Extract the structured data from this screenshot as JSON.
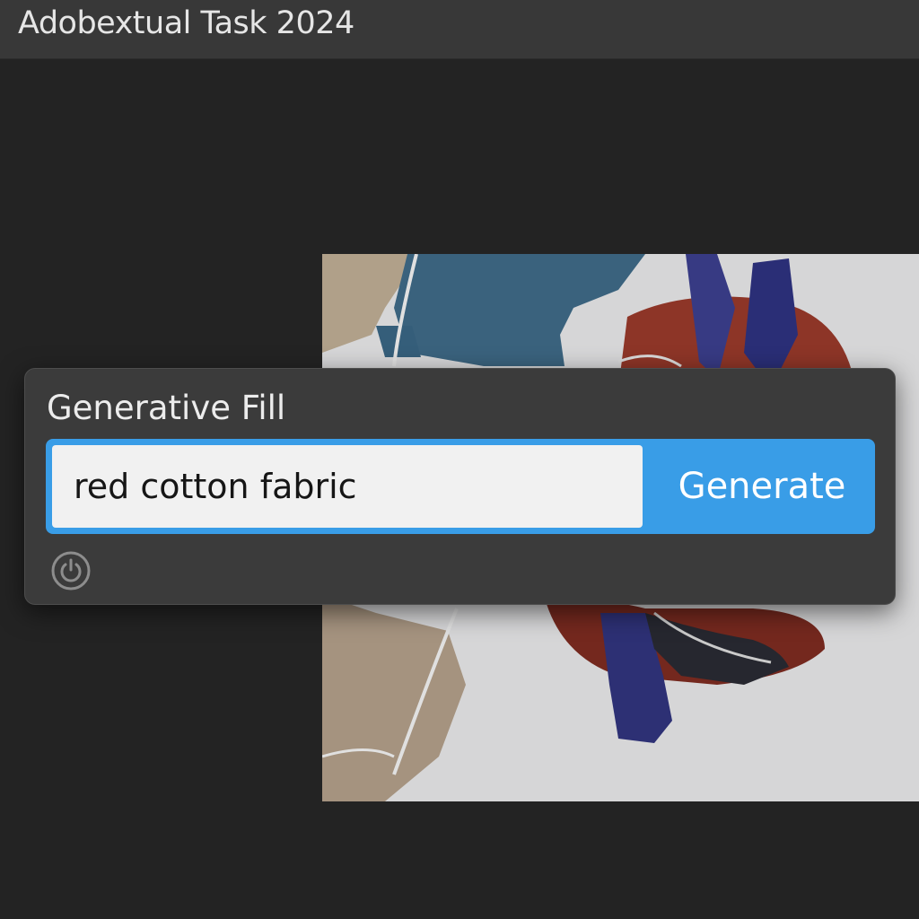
{
  "app": {
    "title": "Adobextual Task 2024"
  },
  "panel": {
    "title": "Generative Fill",
    "prompt_value": "red cotton fabric",
    "generate_label": "Generate",
    "history_icon": "power-refresh-icon"
  },
  "colors": {
    "accent": "#399de7",
    "panel_bg": "#3b3b3b",
    "app_bg": "#232323",
    "title_bar_bg": "#383838"
  }
}
